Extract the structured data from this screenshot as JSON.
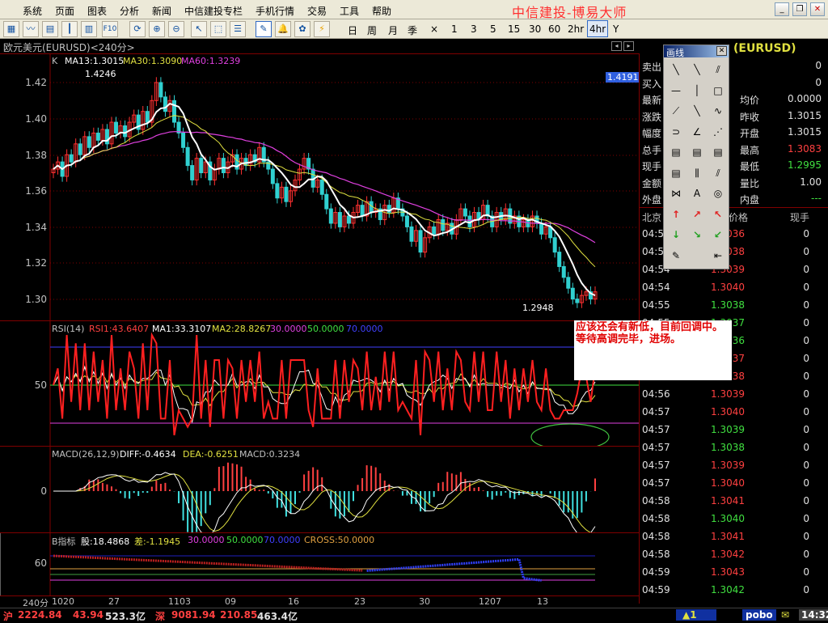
{
  "menu": {
    "items": [
      "系统",
      "页面",
      "图表",
      "分析",
      "新闻",
      "中信建投专栏",
      "手机行情",
      "交易",
      "工具",
      "帮助"
    ],
    "brand": "中信建投-博易大师"
  },
  "toolbar": {
    "periods": [
      "日",
      "周",
      "月",
      "季",
      "×",
      "1",
      "3",
      "5",
      "15",
      "30",
      "60",
      "2hr",
      "4hr",
      "Y"
    ],
    "selected": "4hr"
  },
  "title": "欧元美元(EURUSD)<240分>",
  "main_chart": {
    "legend_k": "K",
    "ma13": "MA13:1.3015",
    "ma30": "MA30:1.3090",
    "ma60": "MA60:1.3239",
    "high_label": "1.4246",
    "low_label": "1.2948",
    "price_tag": "1.4191",
    "yticks": [
      "1.42",
      "1.40",
      "1.38",
      "1.36",
      "1.34",
      "1.32",
      "1.30"
    ],
    "colors": {
      "up": "#ff4040",
      "down": "#40e0e0",
      "ma13": "#ffffff",
      "ma30": "#e0e040",
      "ma60": "#e040e0"
    }
  },
  "rsi_chart": {
    "label": "RSI(14)",
    "rsi1": "RSI1:43.6407",
    "ma1": "MA1:33.3107",
    "ma2": "MA2:28.8267",
    "l1": "30.0000",
    "l2": "50.0000",
    "l3": "70.0000",
    "ytick": "50"
  },
  "macd_chart": {
    "label": "MACD(26,12,9)",
    "diff": "DIFF:-0.4634",
    "dea": "DEA:-0.6251",
    "macd": "MACD:0.3234",
    "ytick": "0"
  },
  "b_chart": {
    "label": "B指标",
    "gu": "股:18.4868",
    "cha": "差:-1.1945",
    "l1": "30.0000",
    "l2": "50.0000",
    "l3": "70.0000",
    "cross": "CROSS:50.0000",
    "ytick": "60"
  },
  "xaxis": {
    "unit": "240分",
    "labels": [
      "1020",
      "27",
      "1103",
      "09",
      "16",
      "23",
      "30",
      "1207",
      "13"
    ]
  },
  "quote": {
    "header": "(EURUSD)",
    "left": [
      {
        "k": "卖出",
        "v": ""
      },
      {
        "k": "买入",
        "v": ""
      },
      {
        "k": "最新",
        "v": ""
      },
      {
        "k": "涨跌",
        "v": ""
      },
      {
        "k": "幅度",
        "v": ""
      },
      {
        "k": "总手",
        "v": ""
      },
      {
        "k": "现手",
        "v": ""
      },
      {
        "k": "金额",
        "v": ""
      },
      {
        "k": "外盘",
        "v": ""
      }
    ],
    "right": [
      {
        "k": "",
        "v": "0"
      },
      {
        "k": "",
        "v": "0"
      },
      {
        "k": "均价",
        "v": "0.0000"
      },
      {
        "k": "昨收",
        "v": "1.3015"
      },
      {
        "k": "开盘",
        "v": "1.3015"
      },
      {
        "k": "最高",
        "v": "1.3083"
      },
      {
        "k": "最低",
        "v": "1.2995"
      },
      {
        "k": "量比",
        "v": "1.00"
      },
      {
        "k": "内盘",
        "v": "---"
      }
    ],
    "ticks_header": {
      "time": "北京",
      "price": "价格",
      "vol": "现手"
    },
    "ticks": [
      {
        "t": "04:53",
        "p": "1.3036",
        "v": "0",
        "c": "red"
      },
      {
        "t": "04:54",
        "p": "1.3038",
        "v": "0",
        "c": "red"
      },
      {
        "t": "04:54",
        "p": "1.3039",
        "v": "0",
        "c": "red"
      },
      {
        "t": "04:54",
        "p": "1.3040",
        "v": "0",
        "c": "red"
      },
      {
        "t": "04:55",
        "p": "1.3038",
        "v": "0",
        "c": "green"
      },
      {
        "t": "04:55",
        "p": "1.3037",
        "v": "0",
        "c": "green"
      },
      {
        "t": "04:55",
        "p": "1.3036",
        "v": "0",
        "c": "green"
      },
      {
        "t": "04:56",
        "p": "1.3037",
        "v": "0",
        "c": "red"
      },
      {
        "t": "04:56",
        "p": "1.3038",
        "v": "0",
        "c": "red"
      },
      {
        "t": "04:56",
        "p": "1.3039",
        "v": "0",
        "c": "red"
      },
      {
        "t": "04:57",
        "p": "1.3040",
        "v": "0",
        "c": "red"
      },
      {
        "t": "04:57",
        "p": "1.3039",
        "v": "0",
        "c": "green"
      },
      {
        "t": "04:57",
        "p": "1.3038",
        "v": "0",
        "c": "green"
      },
      {
        "t": "04:57",
        "p": "1.3039",
        "v": "0",
        "c": "red"
      },
      {
        "t": "04:57",
        "p": "1.3040",
        "v": "0",
        "c": "red"
      },
      {
        "t": "04:58",
        "p": "1.3041",
        "v": "0",
        "c": "red"
      },
      {
        "t": "04:58",
        "p": "1.3040",
        "v": "0",
        "c": "green"
      },
      {
        "t": "04:58",
        "p": "1.3041",
        "v": "0",
        "c": "red"
      },
      {
        "t": "04:58",
        "p": "1.3042",
        "v": "0",
        "c": "red"
      },
      {
        "t": "04:59",
        "p": "1.3043",
        "v": "0",
        "c": "red"
      },
      {
        "t": "04:59",
        "p": "1.3042",
        "v": "0",
        "c": "green"
      }
    ]
  },
  "draw_tool": {
    "title": "画线"
  },
  "annotation": "应该还会有新低，目前回调中。等待高调完毕，进场。",
  "status": {
    "sh": "沪",
    "sh_idx": "2224.84",
    "sh_chg": "43.94",
    "sh_amt": "523.3亿",
    "sz": "深",
    "sz_idx": "9081.94",
    "sz_chg": "210.85",
    "sz_amt": "463.4亿",
    "alert": "▲1",
    "logo": "pobo",
    "time": "14:32"
  }
}
